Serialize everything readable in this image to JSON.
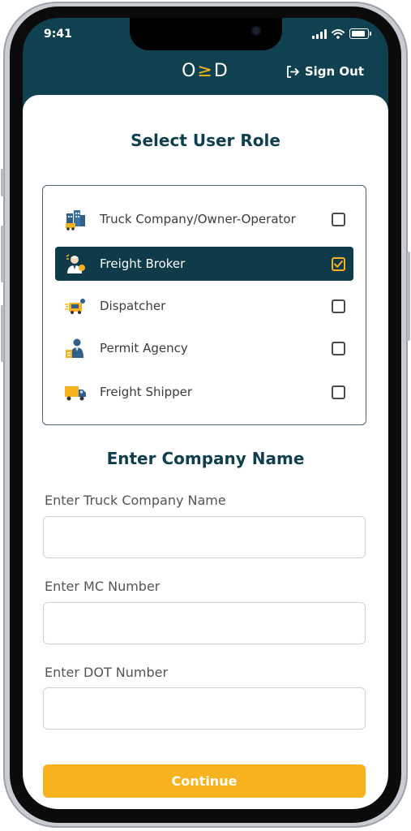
{
  "status_bar": {
    "time": "9:41"
  },
  "header": {
    "logo": {
      "left": "O",
      "mid": "≥",
      "right": "D"
    },
    "sign_out_label": "Sign Out"
  },
  "roles": {
    "title": "Select User Role",
    "items": [
      {
        "label": "Truck Company/Owner-Operator",
        "icon": "truck-company-icon",
        "checked": false
      },
      {
        "label": "Freight Broker",
        "icon": "freight-broker-icon",
        "checked": true
      },
      {
        "label": "Dispatcher",
        "icon": "dispatcher-icon",
        "checked": false
      },
      {
        "label": "Permit Agency",
        "icon": "permit-agency-icon",
        "checked": false
      },
      {
        "label": "Freight Shipper",
        "icon": "freight-shipper-icon",
        "checked": false
      }
    ]
  },
  "company": {
    "title": "Enter Company Name",
    "fields": [
      {
        "label": "Enter Truck Company Name",
        "value": "",
        "placeholder": ""
      },
      {
        "label": "Enter MC Number",
        "value": "",
        "placeholder": ""
      },
      {
        "label": "Enter DOT Number",
        "value": "",
        "placeholder": ""
      }
    ]
  },
  "continue_label": "Continue",
  "colors": {
    "primary": "#0f4150",
    "accent": "#f7b21d",
    "selected_row": "#0f3a4a"
  }
}
